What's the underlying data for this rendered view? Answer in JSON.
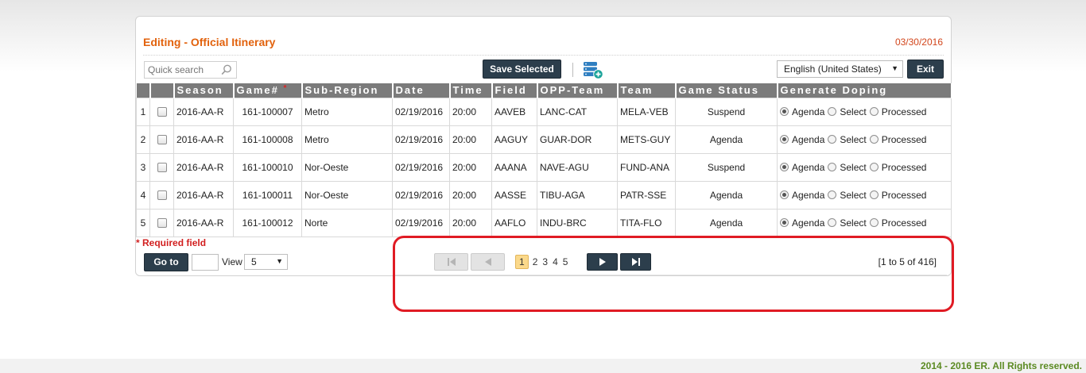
{
  "header": {
    "title": "Editing - Official Itinerary",
    "date": "03/30/2016"
  },
  "toolbar": {
    "search_placeholder": "Quick search",
    "save_label": "Save Selected",
    "language": "English (United States)",
    "exit_label": "Exit"
  },
  "table": {
    "columns": [
      "Season",
      "Game#",
      "Sub-Region",
      "Date",
      "Time",
      "Field",
      "OPP-Team",
      "Team",
      "Game Status",
      "Generate Doping"
    ],
    "required_mark": "*",
    "radio_labels": [
      "Agenda",
      "Select",
      "Processed"
    ],
    "rows": [
      {
        "num": "1",
        "season": "2016-AA-R",
        "game": "161-100007",
        "subregion": "Metro",
        "date": "02/19/2016",
        "time": "20:00",
        "field": "AAVEB",
        "opp": "LANC-CAT",
        "team": "MELA-VEB",
        "status": "Suspend",
        "doping": "Agenda"
      },
      {
        "num": "2",
        "season": "2016-AA-R",
        "game": "161-100008",
        "subregion": "Metro",
        "date": "02/19/2016",
        "time": "20:00",
        "field": "AAGUY",
        "opp": "GUAR-DOR",
        "team": "METS-GUY",
        "status": "Agenda",
        "doping": "Agenda"
      },
      {
        "num": "3",
        "season": "2016-AA-R",
        "game": "161-100010",
        "subregion": "Nor-Oeste",
        "date": "02/19/2016",
        "time": "20:00",
        "field": "AAANA",
        "opp": "NAVE-AGU",
        "team": "FUND-ANA",
        "status": "Suspend",
        "doping": "Agenda"
      },
      {
        "num": "4",
        "season": "2016-AA-R",
        "game": "161-100011",
        "subregion": "Nor-Oeste",
        "date": "02/19/2016",
        "time": "20:00",
        "field": "AASSE",
        "opp": "TIBU-AGA",
        "team": "PATR-SSE",
        "status": "Agenda",
        "doping": "Agenda"
      },
      {
        "num": "5",
        "season": "2016-AA-R",
        "game": "161-100012",
        "subregion": "Norte",
        "date": "02/19/2016",
        "time": "20:00",
        "field": "AAFLO",
        "opp": "INDU-BRC",
        "team": "TITA-FLO",
        "status": "Agenda",
        "doping": "Agenda"
      }
    ]
  },
  "bottom": {
    "required_star": "*",
    "required_note": "Required field",
    "goto_label": "Go to",
    "view_label": "View",
    "view_value": "5"
  },
  "pager": {
    "pages": [
      "1",
      "2",
      "3",
      "4",
      "5"
    ],
    "current": "1",
    "count": "[1 to 5 of 416]"
  },
  "footer": {
    "text": "2014 - 2016 ER. All Rights reserved."
  },
  "colors": {
    "accent_orange": "#e2620d",
    "dark_button": "#2c3e4c",
    "highlight_red": "#e01b24",
    "footer_green": "#5b8a22"
  }
}
